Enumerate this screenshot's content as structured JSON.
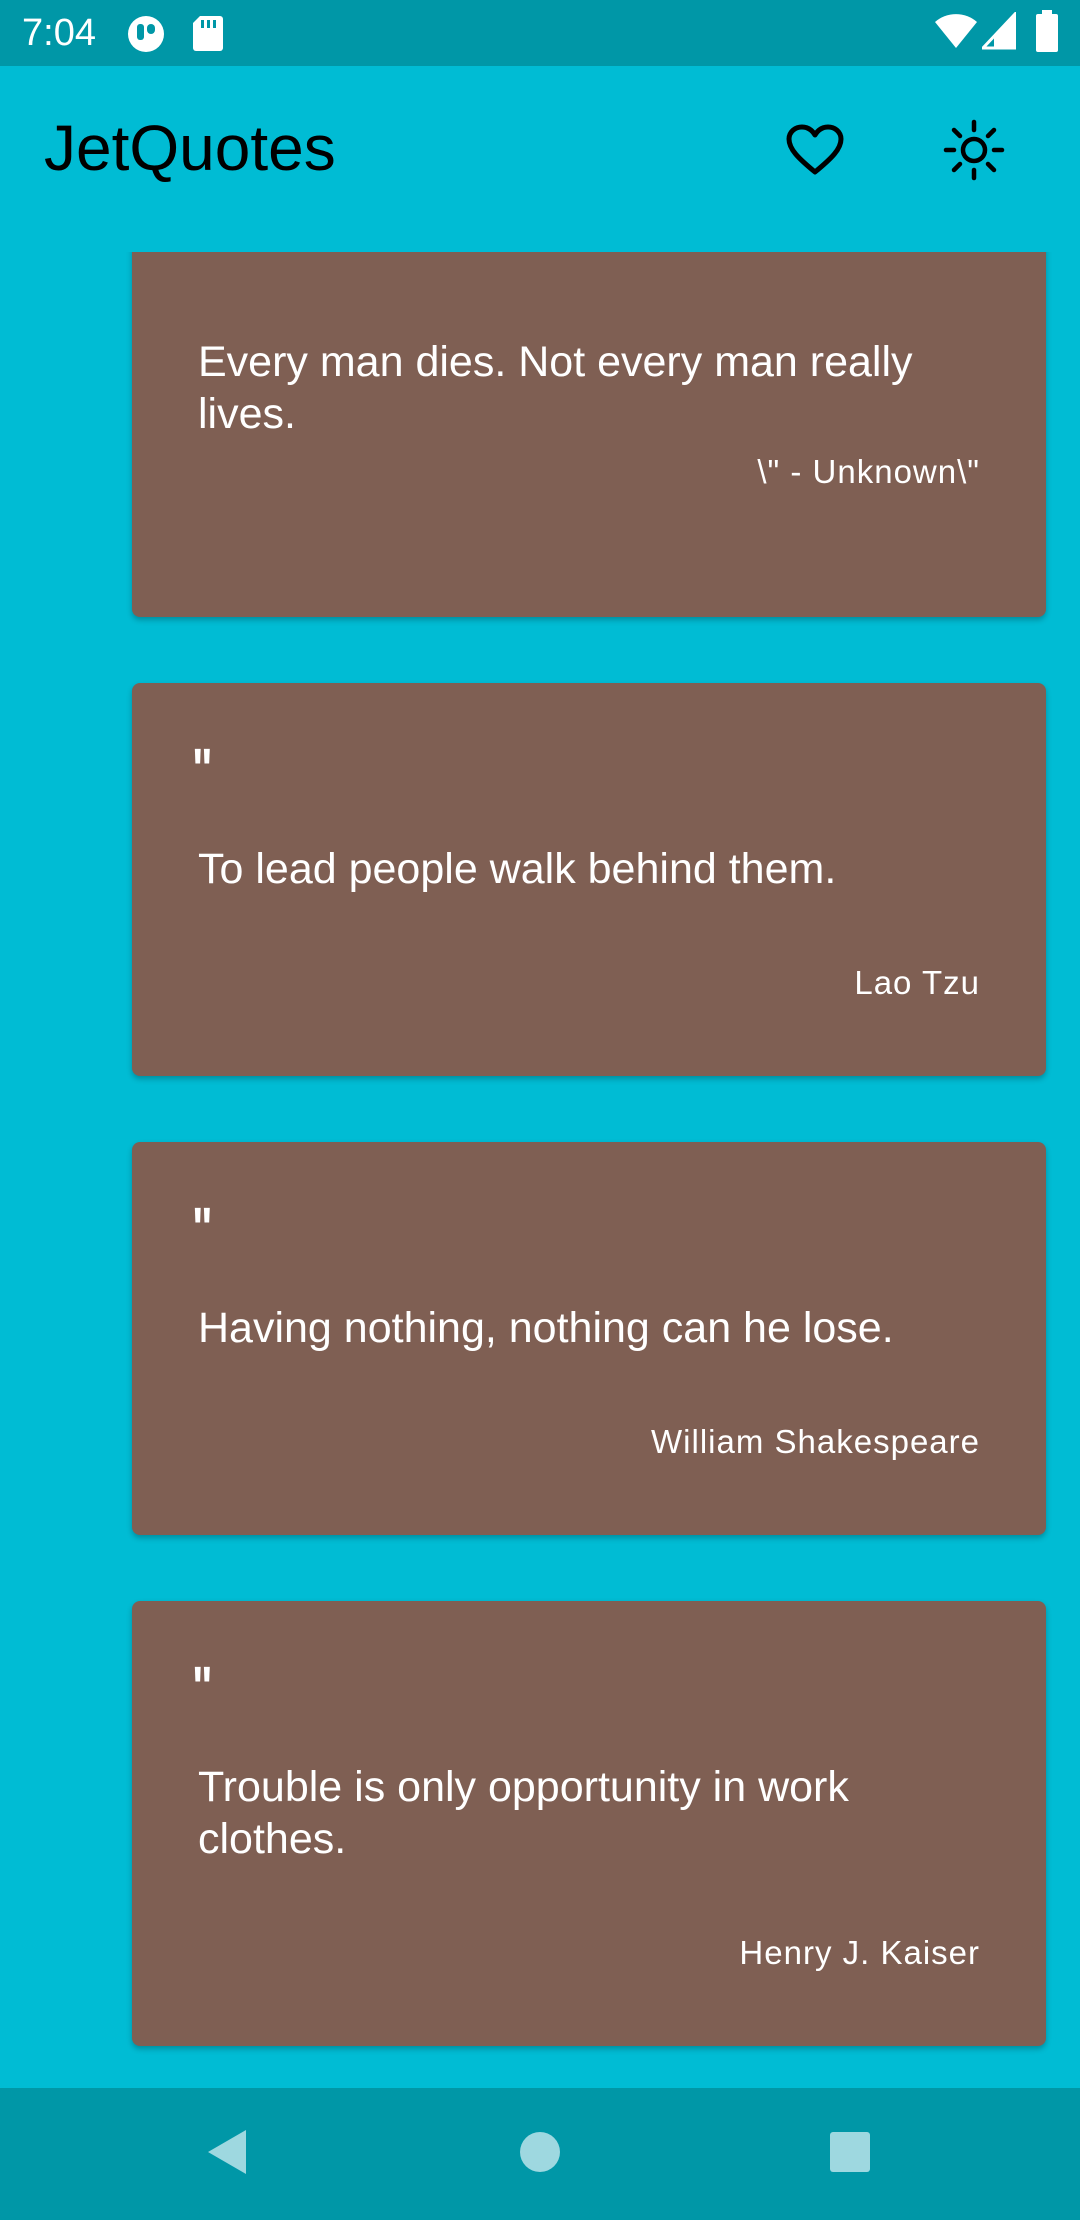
{
  "status_bar": {
    "time": "7:04",
    "left_icons": [
      "notification-app-icon",
      "sd-card-icon"
    ],
    "right_icons": [
      "wifi-icon",
      "cell-signal-icon",
      "battery-icon"
    ]
  },
  "app_bar": {
    "title": "JetQuotes",
    "actions": [
      {
        "name": "favorites",
        "icon": "heart-outline-icon"
      },
      {
        "name": "theme",
        "icon": "sun-icon"
      }
    ]
  },
  "quotes": [
    {
      "mark": "\"",
      "text": "Every man dies. Not every man really lives.",
      "author": "\\\" - Unknown\\\""
    },
    {
      "mark": "\"",
      "text": "To lead people walk behind them.",
      "author": "Lao Tzu"
    },
    {
      "mark": "\"",
      "text": "Having nothing, nothing can he lose.",
      "author": "William Shakespeare"
    },
    {
      "mark": "\"",
      "text": "Trouble is only opportunity in work clothes.",
      "author": "Henry J. Kaiser"
    }
  ],
  "nav_bar": {
    "buttons": [
      "back-icon",
      "home-icon",
      "recents-icon"
    ]
  },
  "colors": {
    "primary": "#00BCD4",
    "primary_dark": "#0097A7",
    "card": "#7F5F53",
    "card_text": "#FFFFFF",
    "title_text": "#000000"
  }
}
